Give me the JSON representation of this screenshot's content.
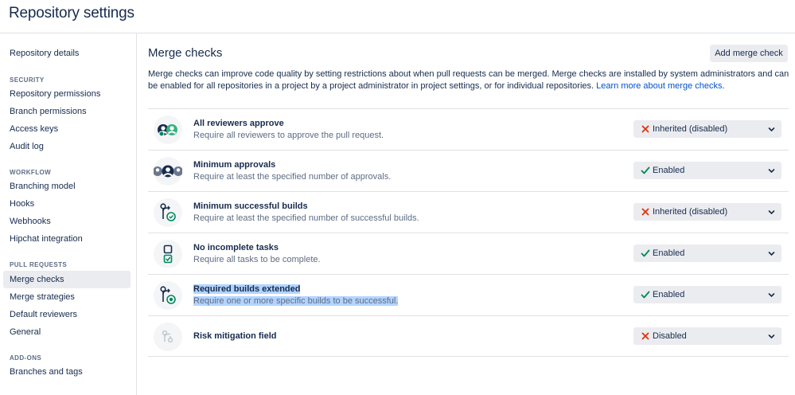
{
  "header": {
    "title": "Repository settings"
  },
  "sidebar": {
    "top_item": "Repository details",
    "sections": [
      {
        "label": "SECURITY",
        "items": [
          "Repository permissions",
          "Branch permissions",
          "Access keys",
          "Audit log"
        ]
      },
      {
        "label": "WORKFLOW",
        "items": [
          "Branching model",
          "Hooks",
          "Webhooks",
          "Hipchat integration"
        ]
      },
      {
        "label": "PULL REQUESTS",
        "items": [
          "Merge checks",
          "Merge strategies",
          "Default reviewers",
          "General"
        ]
      },
      {
        "label": "ADD-ONS",
        "items": [
          "Branches and tags"
        ]
      }
    ],
    "active_item": "Merge checks"
  },
  "main": {
    "title": "Merge checks",
    "add_button": "Add merge check",
    "description": "Merge checks can improve code quality by setting restrictions about when pull requests can be merged. Merge checks are installed by system administrators and can be enabled for all repositories in a project by a project administrator in project settings, or for individual repositories.",
    "learn_more": "Learn more about merge checks",
    "learn_more_suffix": ".",
    "checks": [
      {
        "title": "All reviewers approve",
        "subtitle": "Require all reviewers to approve the pull request.",
        "icon": "reviewers-approve-icon",
        "status": "Inherited (disabled)",
        "status_icon": "cross-icon"
      },
      {
        "title": "Minimum approvals",
        "subtitle": "Require at least the specified number of approvals.",
        "icon": "minimum-approvals-icon",
        "status": "Enabled",
        "status_icon": "check-icon"
      },
      {
        "title": "Minimum successful builds",
        "subtitle": "Require at least the specified number of successful builds.",
        "icon": "builds-icon",
        "status": "Inherited (disabled)",
        "status_icon": "cross-icon"
      },
      {
        "title": "No incomplete tasks",
        "subtitle": "Require all tasks to be complete.",
        "icon": "tasks-icon",
        "status": "Enabled",
        "status_icon": "check-icon"
      },
      {
        "title": "Required builds extended",
        "subtitle": "Require one or more specific builds to be successful.",
        "icon": "required-builds-icon",
        "status": "Enabled",
        "status_icon": "check-icon"
      },
      {
        "title": "Risk mitigation field",
        "subtitle": "",
        "icon": "risk-mitigation-icon",
        "status": "Disabled",
        "status_icon": "cross-icon"
      }
    ]
  },
  "colors": {
    "link": "#0052cc",
    "success": "#00875a",
    "error": "#de350b",
    "select_bg": "#ebecf0",
    "highlight": "#b3d4ff"
  }
}
